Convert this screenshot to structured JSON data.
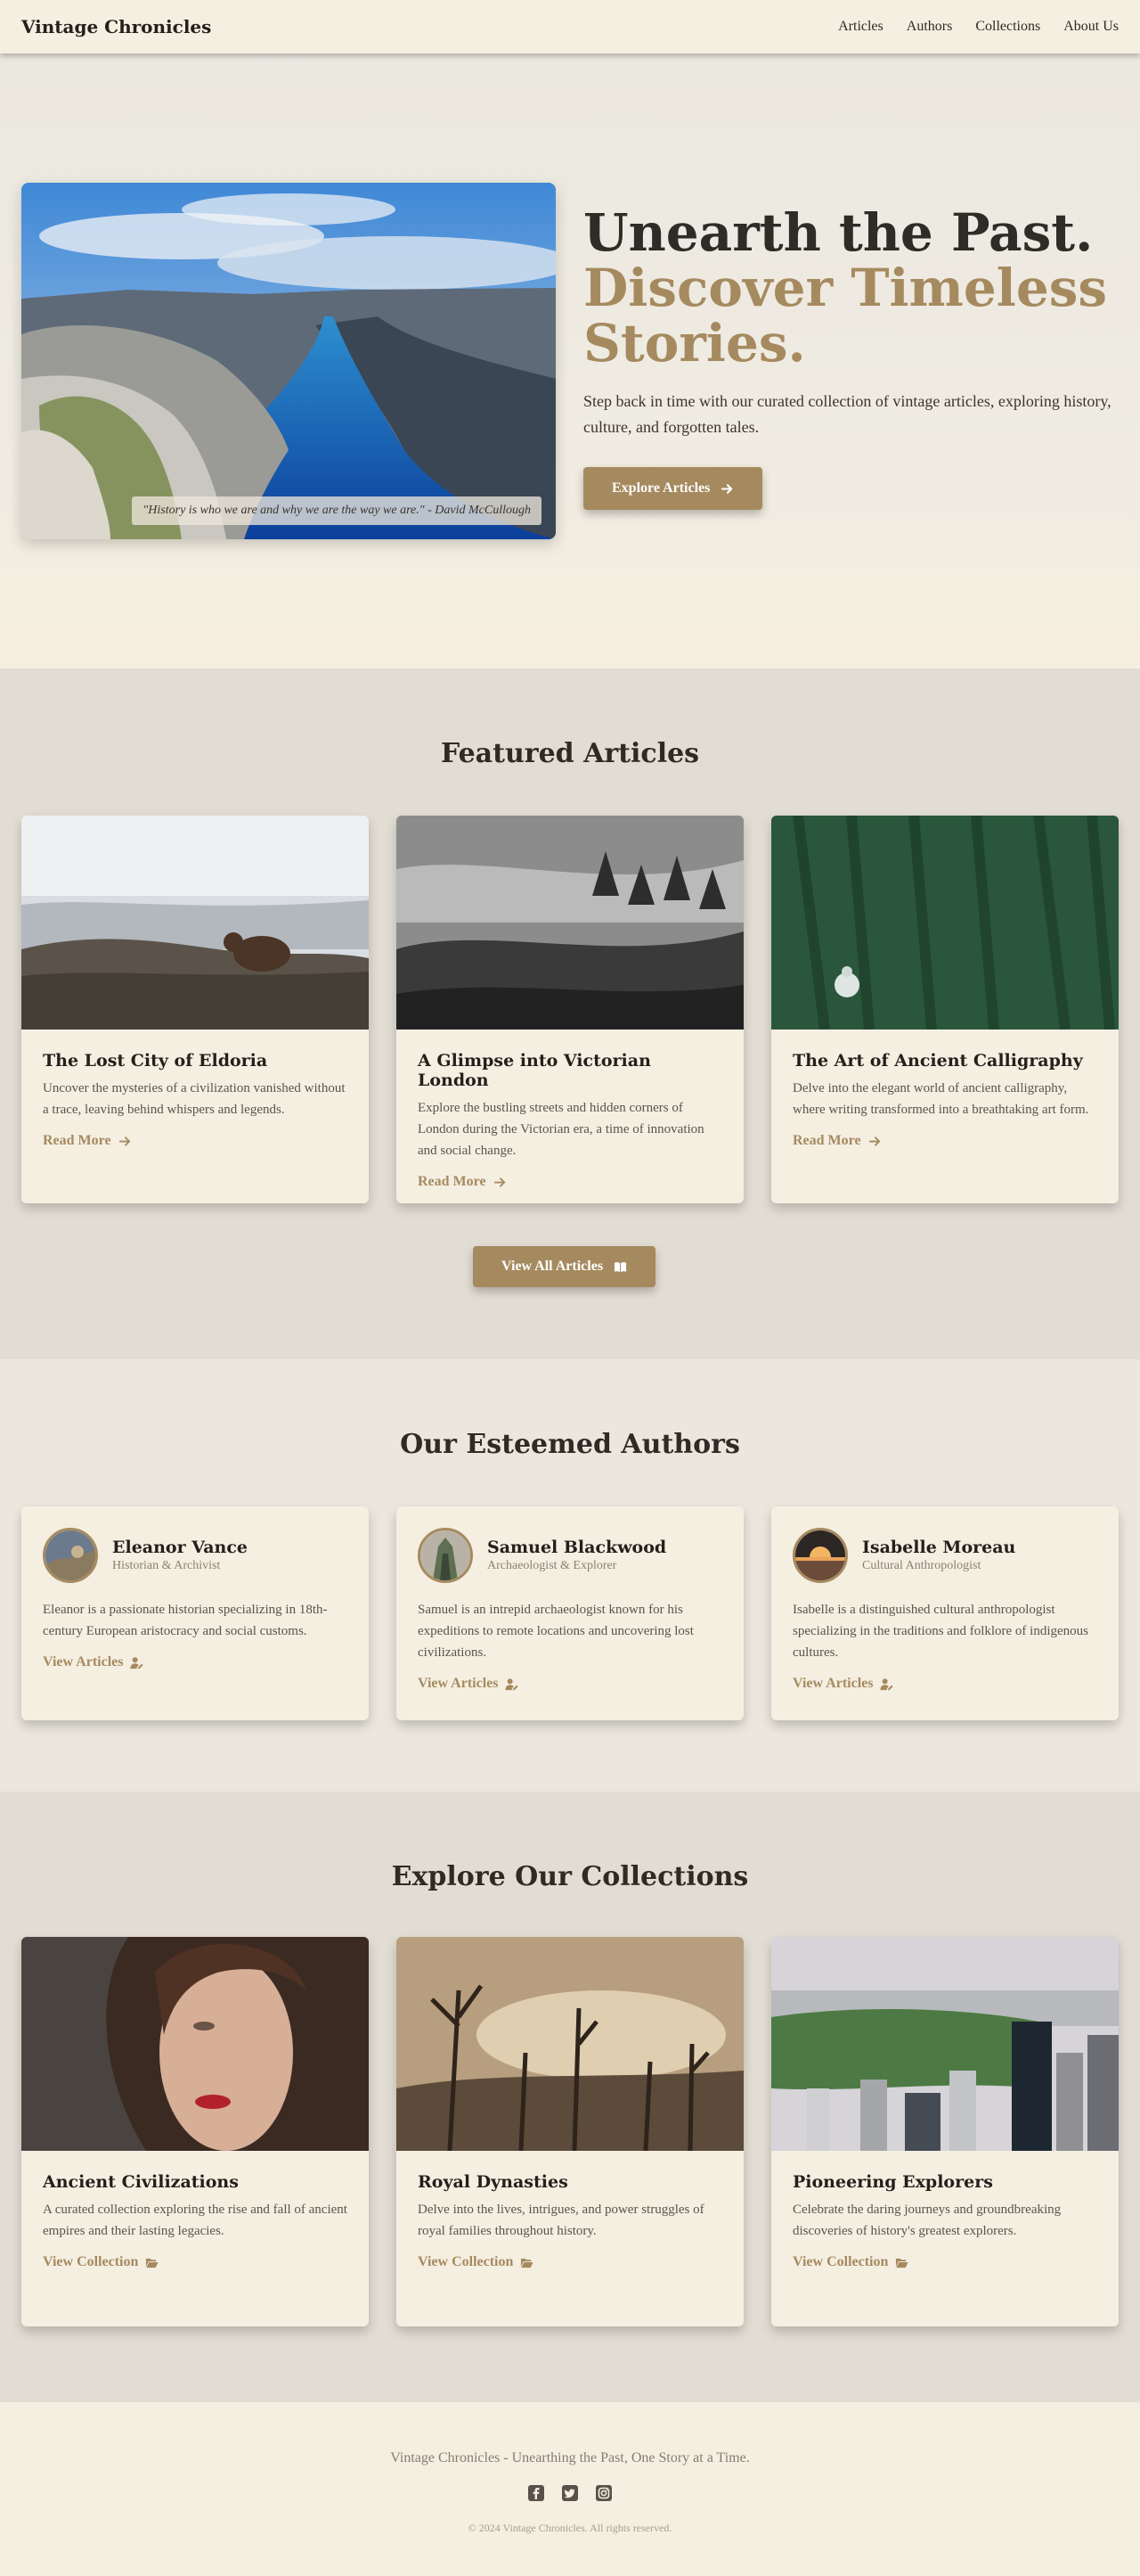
{
  "nav": {
    "brand": "Vintage Chronicles",
    "links": [
      "Articles",
      "Authors",
      "Collections",
      "About Us"
    ]
  },
  "hero": {
    "title_line1": "Unearth the Past.",
    "title_line2": "Discover Timeless",
    "title_line3": "Stories.",
    "subtitle": "Step back in time with our curated collection of vintage articles, exploring history, culture, and forgotten tales.",
    "quote": "\"History is who we are and why we are the way we are.\" - David McCullough",
    "cta_label": "Explore Articles",
    "cta_icon": "arrow-right-icon"
  },
  "featured": {
    "title": "Featured Articles",
    "articles": [
      {
        "title": "The Lost City of Eldoria",
        "description": "Uncover the mysteries of a civilization vanished without a trace, leaving behind whispers and legends.",
        "link": "Read More",
        "image": "bear-on-rocky-hillside"
      },
      {
        "title": "A Glimpse into Victorian London",
        "description": "Explore the bustling streets and hidden corners of London during the Victorian era, a time of innovation and social change.",
        "link": "Read More",
        "image": "misty-black-and-white-forest"
      },
      {
        "title": "The Art of Ancient Calligraphy",
        "description": "Delve into the elegant world of ancient calligraphy, where writing transformed into a breathtaking art form.",
        "link": "Read More",
        "image": "cyclist-in-green-forest"
      }
    ],
    "view_all_label": "View All Articles",
    "view_all_icon": "book-open-icon"
  },
  "authors": {
    "title": "Our Esteemed Authors",
    "list": [
      {
        "name": "Eleanor Vance",
        "role": "Historian & Archivist",
        "bio": "Eleanor is a passionate historian specializing in 18th-century European aristocracy and social customs.",
        "link": "View Articles"
      },
      {
        "name": "Samuel Blackwood",
        "role": "Archaeologist & Explorer",
        "bio": "Samuel is an intrepid archaeologist known for his expeditions to remote locations and uncovering lost civilizations.",
        "link": "View Articles"
      },
      {
        "name": "Isabelle Moreau",
        "role": "Cultural Anthropologist",
        "bio": "Isabelle is a distinguished cultural anthropologist specializing in the traditions and folklore of indigenous cultures.",
        "link": "View Articles"
      }
    ],
    "link_icon": "user-pen-icon"
  },
  "collections": {
    "title": "Explore Our Collections",
    "list": [
      {
        "title": "Ancient Civilizations",
        "description": "A curated collection exploring the rise and fall of ancient empires and their lasting legacies.",
        "link": "View Collection",
        "image": "portrait-woman-red-lips"
      },
      {
        "title": "Royal Dynasties",
        "description": "Delve into the lives, intrigues, and power struggles of royal families throughout history.",
        "link": "View Collection",
        "image": "dead-trees-sepia-landscape"
      },
      {
        "title": "Pioneering Explorers",
        "description": "Celebrate the daring journeys and groundbreaking discoveries of history's greatest explorers.",
        "link": "View Collection",
        "image": "city-skyline-park"
      }
    ],
    "link_icon": "folder-open-icon"
  },
  "footer": {
    "tagline": "Vintage Chronicles - Unearthing the Past, One Story at a Time.",
    "social_icons": [
      "facebook-icon",
      "twitter-icon",
      "instagram-icon"
    ],
    "copyright": "© 2024 Vintage Chronicles. All rights reserved."
  },
  "colors": {
    "accent": "#a68a5f",
    "card_bg": "#f5efe2",
    "text_dark": "#2f2b26"
  }
}
